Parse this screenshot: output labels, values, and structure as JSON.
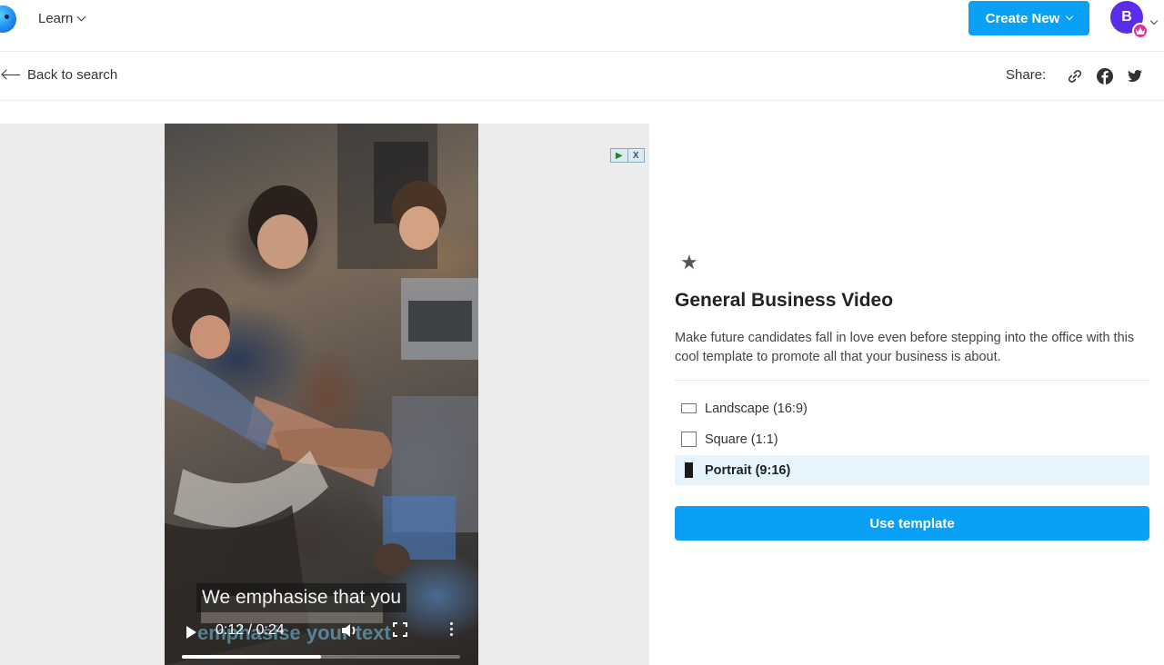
{
  "header": {
    "nav_learn": "Learn",
    "create_new": "Create New",
    "avatar_initial": "B"
  },
  "subbar": {
    "back_label": "Back to search",
    "share_label": "Share:"
  },
  "ad": {
    "x_label": "X"
  },
  "video": {
    "caption_line": "We emphasise that you",
    "caption_overlay": "emphasise your text",
    "time": "0:12 / 0:24",
    "progress": 0.5
  },
  "template": {
    "title": "General Business Video",
    "description": "Make future candidates fall in love even before stepping into the office with this cool template to promote all that your business is about.",
    "formats": [
      {
        "label": "Landscape (16:9)",
        "selected": false
      },
      {
        "label": "Square (1:1)",
        "selected": false
      },
      {
        "label": "Portrait (9:16)",
        "selected": true
      }
    ],
    "use_button": "Use template"
  },
  "colors": {
    "accent": "#0aa0f5",
    "avatar": "#5a2ee8",
    "selected_bg": "#e6f4fd"
  }
}
